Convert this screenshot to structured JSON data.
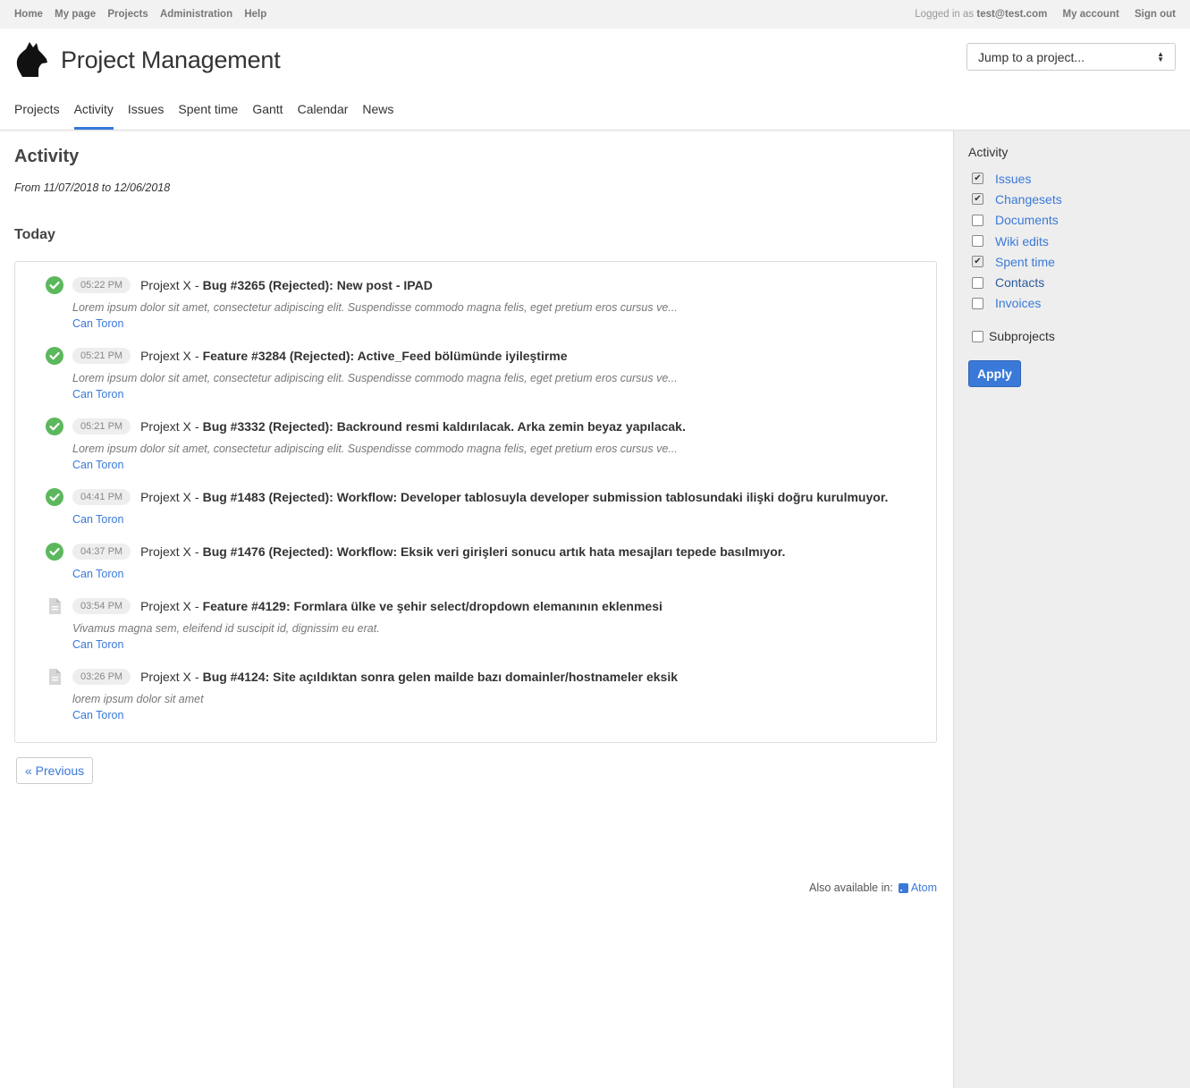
{
  "topbar": {
    "left": [
      "Home",
      "My page",
      "Projects",
      "Administration",
      "Help"
    ],
    "logged_prefix": "Logged in as",
    "user": "test@test.com",
    "my_account": "My account",
    "sign_out": "Sign out"
  },
  "header": {
    "title": "Project Management",
    "jump_placeholder": "Jump to a project..."
  },
  "menu": [
    "Projects",
    "Activity",
    "Issues",
    "Spent time",
    "Gantt",
    "Calendar",
    "News"
  ],
  "main": {
    "title": "Activity",
    "range": "From 11/07/2018 to 12/06/2018",
    "day": "Today",
    "events": [
      {
        "icon": "check-circle-icon",
        "time": "05:22 PM",
        "project": "Projext X",
        "title": "Bug #3265 (Rejected): New post - IPAD",
        "desc": "Lorem ipsum dolor sit amet, consectetur adipiscing elit. Suspendisse commodo magna felis, eget pretium eros cursus ve...",
        "author": "Can Toron"
      },
      {
        "icon": "check-circle-icon",
        "time": "05:21 PM",
        "project": "Projext X",
        "title": "Feature #3284 (Rejected): Active_Feed bölümünde iyileştirme",
        "desc": "Lorem ipsum dolor sit amet, consectetur adipiscing elit. Suspendisse commodo magna felis, eget pretium eros cursus ve...",
        "author": "Can Toron"
      },
      {
        "icon": "check-circle-icon",
        "time": "05:21 PM",
        "project": "Projext X",
        "title": "Bug #3332 (Rejected): Backround resmi kaldırılacak. Arka zemin beyaz yapılacak.",
        "desc": "Lorem ipsum dolor sit amet, consectetur adipiscing elit. Suspendisse commodo magna felis, eget pretium eros cursus ve...",
        "author": "Can Toron"
      },
      {
        "icon": "check-circle-icon",
        "time": "04:41 PM",
        "project": "Projext X",
        "title": "Bug #1483 (Rejected): Workflow: Developer tablosuyla developer submission tablosundaki ilişki doğru kurulmuyor.",
        "desc": "",
        "author": "Can Toron"
      },
      {
        "icon": "check-circle-icon",
        "time": "04:37 PM",
        "project": "Projext X",
        "title": "Bug #1476 (Rejected): Workflow: Eksik veri girişleri sonucu artık hata mesajları tepede basılmıyor.",
        "desc": "",
        "author": "Can Toron"
      },
      {
        "icon": "document-icon",
        "time": "03:54 PM",
        "project": "Projext X",
        "title": "Feature #4129: Formlara ülke ve şehir select/dropdown elemanının eklenmesi",
        "desc": "Vivamus magna sem, eleifend id suscipit id, dignissim eu erat.",
        "author": "Can Toron"
      },
      {
        "icon": "document-icon",
        "time": "03:26 PM",
        "project": "Projext X",
        "title": "Bug #4124: Site açıldıktan sonra gelen mailde bazı domainler/hostnameler eksik",
        "desc": "lorem ipsum dolor sit amet",
        "author": "Can Toron"
      }
    ],
    "previous": "« Previous",
    "also_available": "Also available in:",
    "atom": "Atom"
  },
  "sidebar": {
    "title": "Activity",
    "filters": [
      {
        "label": "Issues",
        "checked": true
      },
      {
        "label": "Changesets",
        "checked": true
      },
      {
        "label": "Documents",
        "checked": false
      },
      {
        "label": "Wiki edits",
        "checked": false
      },
      {
        "label": "Spent time",
        "checked": true
      },
      {
        "label": "Contacts",
        "checked": false
      },
      {
        "label": "Invoices",
        "checked": false
      }
    ],
    "subprojects": "Subprojects",
    "apply": "Apply"
  },
  "colors": {
    "accent": "#3a79d8",
    "success": "#5cb85c"
  }
}
